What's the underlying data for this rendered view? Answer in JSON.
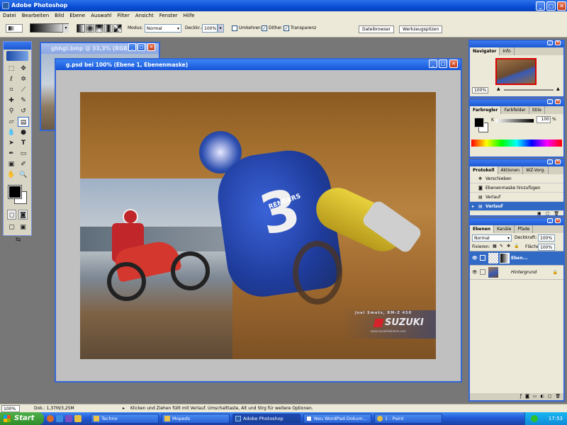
{
  "app": {
    "title": "Adobe Photoshop"
  },
  "window_buttons": {
    "minimize": "_",
    "maximize": "□",
    "close": "✕"
  },
  "menu": [
    "Datei",
    "Bearbeiten",
    "Bild",
    "Ebene",
    "Auswahl",
    "Filter",
    "Ansicht",
    "Fenster",
    "Hilfe"
  ],
  "options": {
    "mode_label": "Modus:",
    "mode_value": "Normal",
    "opacity_label": "Deckkr.:",
    "opacity_value": "100%",
    "reverse_label": "Umkehren",
    "dither_label": "Dither",
    "transparency_label": "Transparenz",
    "reverse_checked": false,
    "dither_checked": true,
    "transparency_checked": true
  },
  "palette_well": {
    "filebrowser": "Dateibrowser",
    "toolpresets": "Werkzeugspitzen"
  },
  "doc_back": {
    "title": "ghhgl.bmp @ 33,3% (RGB)"
  },
  "doc_main": {
    "title": "g.psd bei 100% (Ebene 1, Ebenenmaske)"
  },
  "photo": {
    "caption_rider": "Joel Smets, RM-Z 450",
    "brand": "SUZUKI",
    "url": "www.suzuki4wheels.com",
    "rider_number": "3",
    "jersey_text": "RENDERS"
  },
  "navigator": {
    "tabs": [
      "Navigator",
      "Info"
    ],
    "zoom": "100%"
  },
  "color_panel": {
    "tabs": [
      "Farbregler",
      "Farbfelder",
      "Stile"
    ],
    "channel": "K",
    "value": "100",
    "unit": "%"
  },
  "history": {
    "tabs": [
      "Protokoll",
      "Aktionen",
      "WZ-Vorg."
    ],
    "items": [
      {
        "label": "Verschieben",
        "active": false
      },
      {
        "label": "Ebenenmaske hinzufügen",
        "active": false
      },
      {
        "label": "Verlauf",
        "active": false
      },
      {
        "label": "Verlauf",
        "active": true
      }
    ]
  },
  "layers": {
    "tabs": [
      "Ebenen",
      "Kanäle",
      "Pfade"
    ],
    "blend_mode": "Normal",
    "opacity_label": "Deckkraft:",
    "opacity_value": "100%",
    "lock_label": "Fixieren:",
    "fill_label": "Fläche",
    "fill_value": "100%",
    "items": [
      {
        "name": "Eben...",
        "active": true
      },
      {
        "name": "Hintergrund",
        "active": false
      }
    ]
  },
  "status": {
    "zoom": "100%",
    "doc": "Dok.: 1,37M/3,25M",
    "hint": "Klicken und Ziehen füllt mit Verlauf. Umschalttaste, Alt und Strg für weitere Optionen."
  },
  "taskbar": {
    "start": "Start",
    "tasks": [
      {
        "label": "Techno",
        "active": false
      },
      {
        "label": "Mopeds",
        "active": false
      },
      {
        "label": "Adobe Photoshop",
        "active": true
      },
      {
        "label": "Neu WordPad-Dokum...",
        "active": false
      },
      {
        "label": "1 - Paint",
        "active": false
      }
    ],
    "clock": "17:53"
  },
  "colors": {
    "xp_blue": "#0a4ed6",
    "selection": "#316ac5",
    "workspace": "#777777"
  }
}
